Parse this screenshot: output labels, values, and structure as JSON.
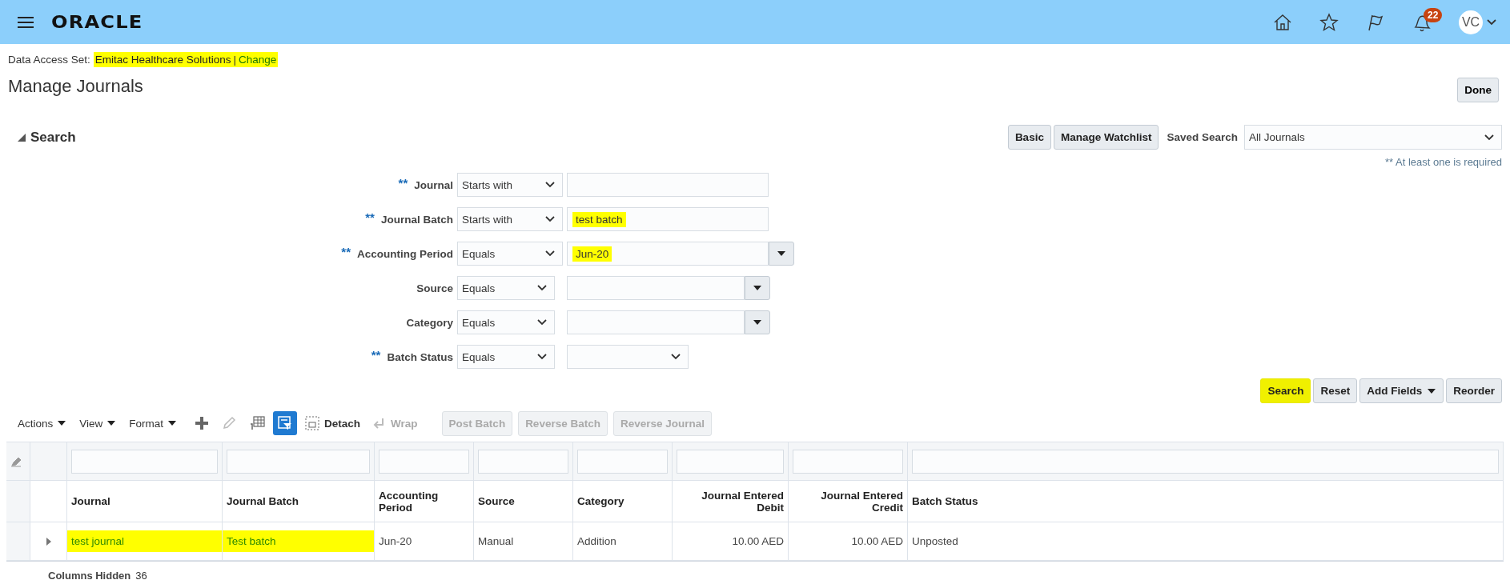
{
  "header": {
    "logo": "ORACLE",
    "notification_count": "22",
    "avatar_initials": "VC"
  },
  "data_access": {
    "label": "Data Access Set:",
    "value": "Emitac Healthcare Solutions",
    "separator": "|",
    "link": "Change",
    "highlighted": true
  },
  "page_title": "Manage Journals",
  "done_button": "Done",
  "search": {
    "title": "Search",
    "expanded": true,
    "buttons": [
      {
        "label": "Basic"
      },
      {
        "label": "Manage Watchlist"
      }
    ],
    "saved_search": {
      "label": "Saved Search",
      "value": "All Journals"
    },
    "required_note": "** At least one is required",
    "fields": [
      {
        "label": "Journal",
        "marker": "**",
        "operator": "Starts with",
        "kind": "text"
      },
      {
        "label": "Journal Batch",
        "marker": "**",
        "operator": "Starts with",
        "kind": "text",
        "value": "test batch",
        "highlighted": true
      },
      {
        "label": "Accounting Period",
        "marker": "**",
        "operator": "Equals",
        "kind": "list",
        "value": "Jun-20",
        "highlighted": true
      },
      {
        "label": "Source",
        "operator": "Equals",
        "kind": "list"
      },
      {
        "label": "Category",
        "operator": "Equals",
        "kind": "list"
      },
      {
        "label": "Batch Status",
        "marker": "**",
        "operator": "Equals",
        "kind": "select"
      }
    ],
    "actions": [
      {
        "label": "Search",
        "kind": "button",
        "highlighted": true
      },
      {
        "label": "Reset",
        "kind": "button",
        "highlighted": false
      },
      {
        "label": "Add Fields",
        "kind": "menu",
        "highlighted": false
      },
      {
        "label": "Reorder",
        "kind": "button",
        "highlighted": false
      }
    ]
  },
  "toolbar": {
    "menus": [
      "Actions",
      "View",
      "Format"
    ],
    "tools": [
      {
        "kind": "add",
        "disabled": false
      },
      {
        "kind": "edit",
        "disabled": true
      },
      {
        "kind": "freeze",
        "disabled": false
      },
      {
        "kind": "filter",
        "on": true
      },
      {
        "kind": "detach",
        "label": "Detach",
        "disabled": false
      },
      {
        "kind": "wrap",
        "label": "Wrap",
        "disabled": true
      }
    ],
    "buttons": [
      {
        "label": "Post Batch",
        "disabled": true
      },
      {
        "label": "Reverse Batch",
        "disabled": true
      },
      {
        "label": "Reverse Journal",
        "disabled": true
      }
    ]
  },
  "table": {
    "columns": [
      {
        "label": "Journal",
        "kind": "text"
      },
      {
        "label": "Journal Batch",
        "kind": "text"
      },
      {
        "label": "Accounting Period",
        "kind": "text"
      },
      {
        "label": "Source",
        "kind": "text"
      },
      {
        "label": "Category",
        "kind": "text"
      },
      {
        "label": "Journal Entered Debit",
        "kind": "amount"
      },
      {
        "label": "Journal Entered Credit",
        "kind": "amount"
      },
      {
        "label": "Batch Status",
        "kind": "text"
      }
    ],
    "rows": [
      {
        "expanded": false,
        "cells": [
          {
            "text": "test journal",
            "kind": "link",
            "highlighted": true
          },
          {
            "text": "Test batch",
            "kind": "link",
            "highlighted": true
          },
          {
            "text": "Jun-20",
            "kind": "text",
            "highlighted": false
          },
          {
            "text": "Manual",
            "kind": "text",
            "highlighted": false
          },
          {
            "text": "Addition",
            "kind": "text",
            "highlighted": false
          },
          {
            "text": "10.00 AED",
            "kind": "text",
            "highlighted": false
          },
          {
            "text": "10.00 AED",
            "kind": "text",
            "highlighted": false
          },
          {
            "text": "Unposted",
            "kind": "text",
            "highlighted": false
          }
        ]
      }
    ]
  },
  "footer": {
    "label": "Columns Hidden",
    "value": "36"
  }
}
